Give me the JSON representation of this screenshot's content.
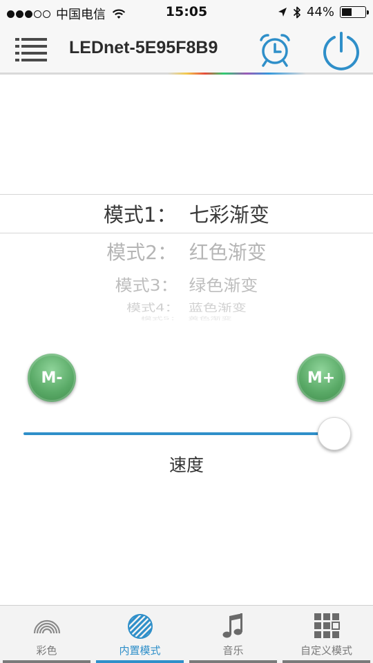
{
  "status_bar": {
    "carrier": "中国电信",
    "time": "15:05",
    "battery_text": "44%",
    "battery_level": 0.44,
    "signal_bars_filled": 3,
    "signal_bars_total": 5
  },
  "header": {
    "title": "LEDnet-5E95F8B9",
    "icons": [
      "menu-icon",
      "alarm-clock-icon",
      "power-icon"
    ]
  },
  "picker": {
    "selected": "模式1：  七彩渐变",
    "items": [
      "模式2：  红色渐变",
      "模式3：  绿色渐变",
      "模式4：  蓝色渐变",
      "模式5：  黄色渐变"
    ]
  },
  "controls": {
    "mode_minus_label": "M-",
    "mode_plus_label": "M+",
    "speed_label": "速度",
    "speed_value": 1.0
  },
  "tabs": [
    {
      "label": "彩色",
      "icon": "rainbow-icon",
      "active": false
    },
    {
      "label": "内置模式",
      "icon": "striped-circle-icon",
      "active": true
    },
    {
      "label": "音乐",
      "icon": "music-note-icon",
      "active": false
    },
    {
      "label": "自定义模式",
      "icon": "grid-icon",
      "active": false
    }
  ],
  "colors": {
    "accent": "#2f8fc9",
    "mode_button": "#5aaa67",
    "tab_inactive": "#7a7a7a"
  }
}
